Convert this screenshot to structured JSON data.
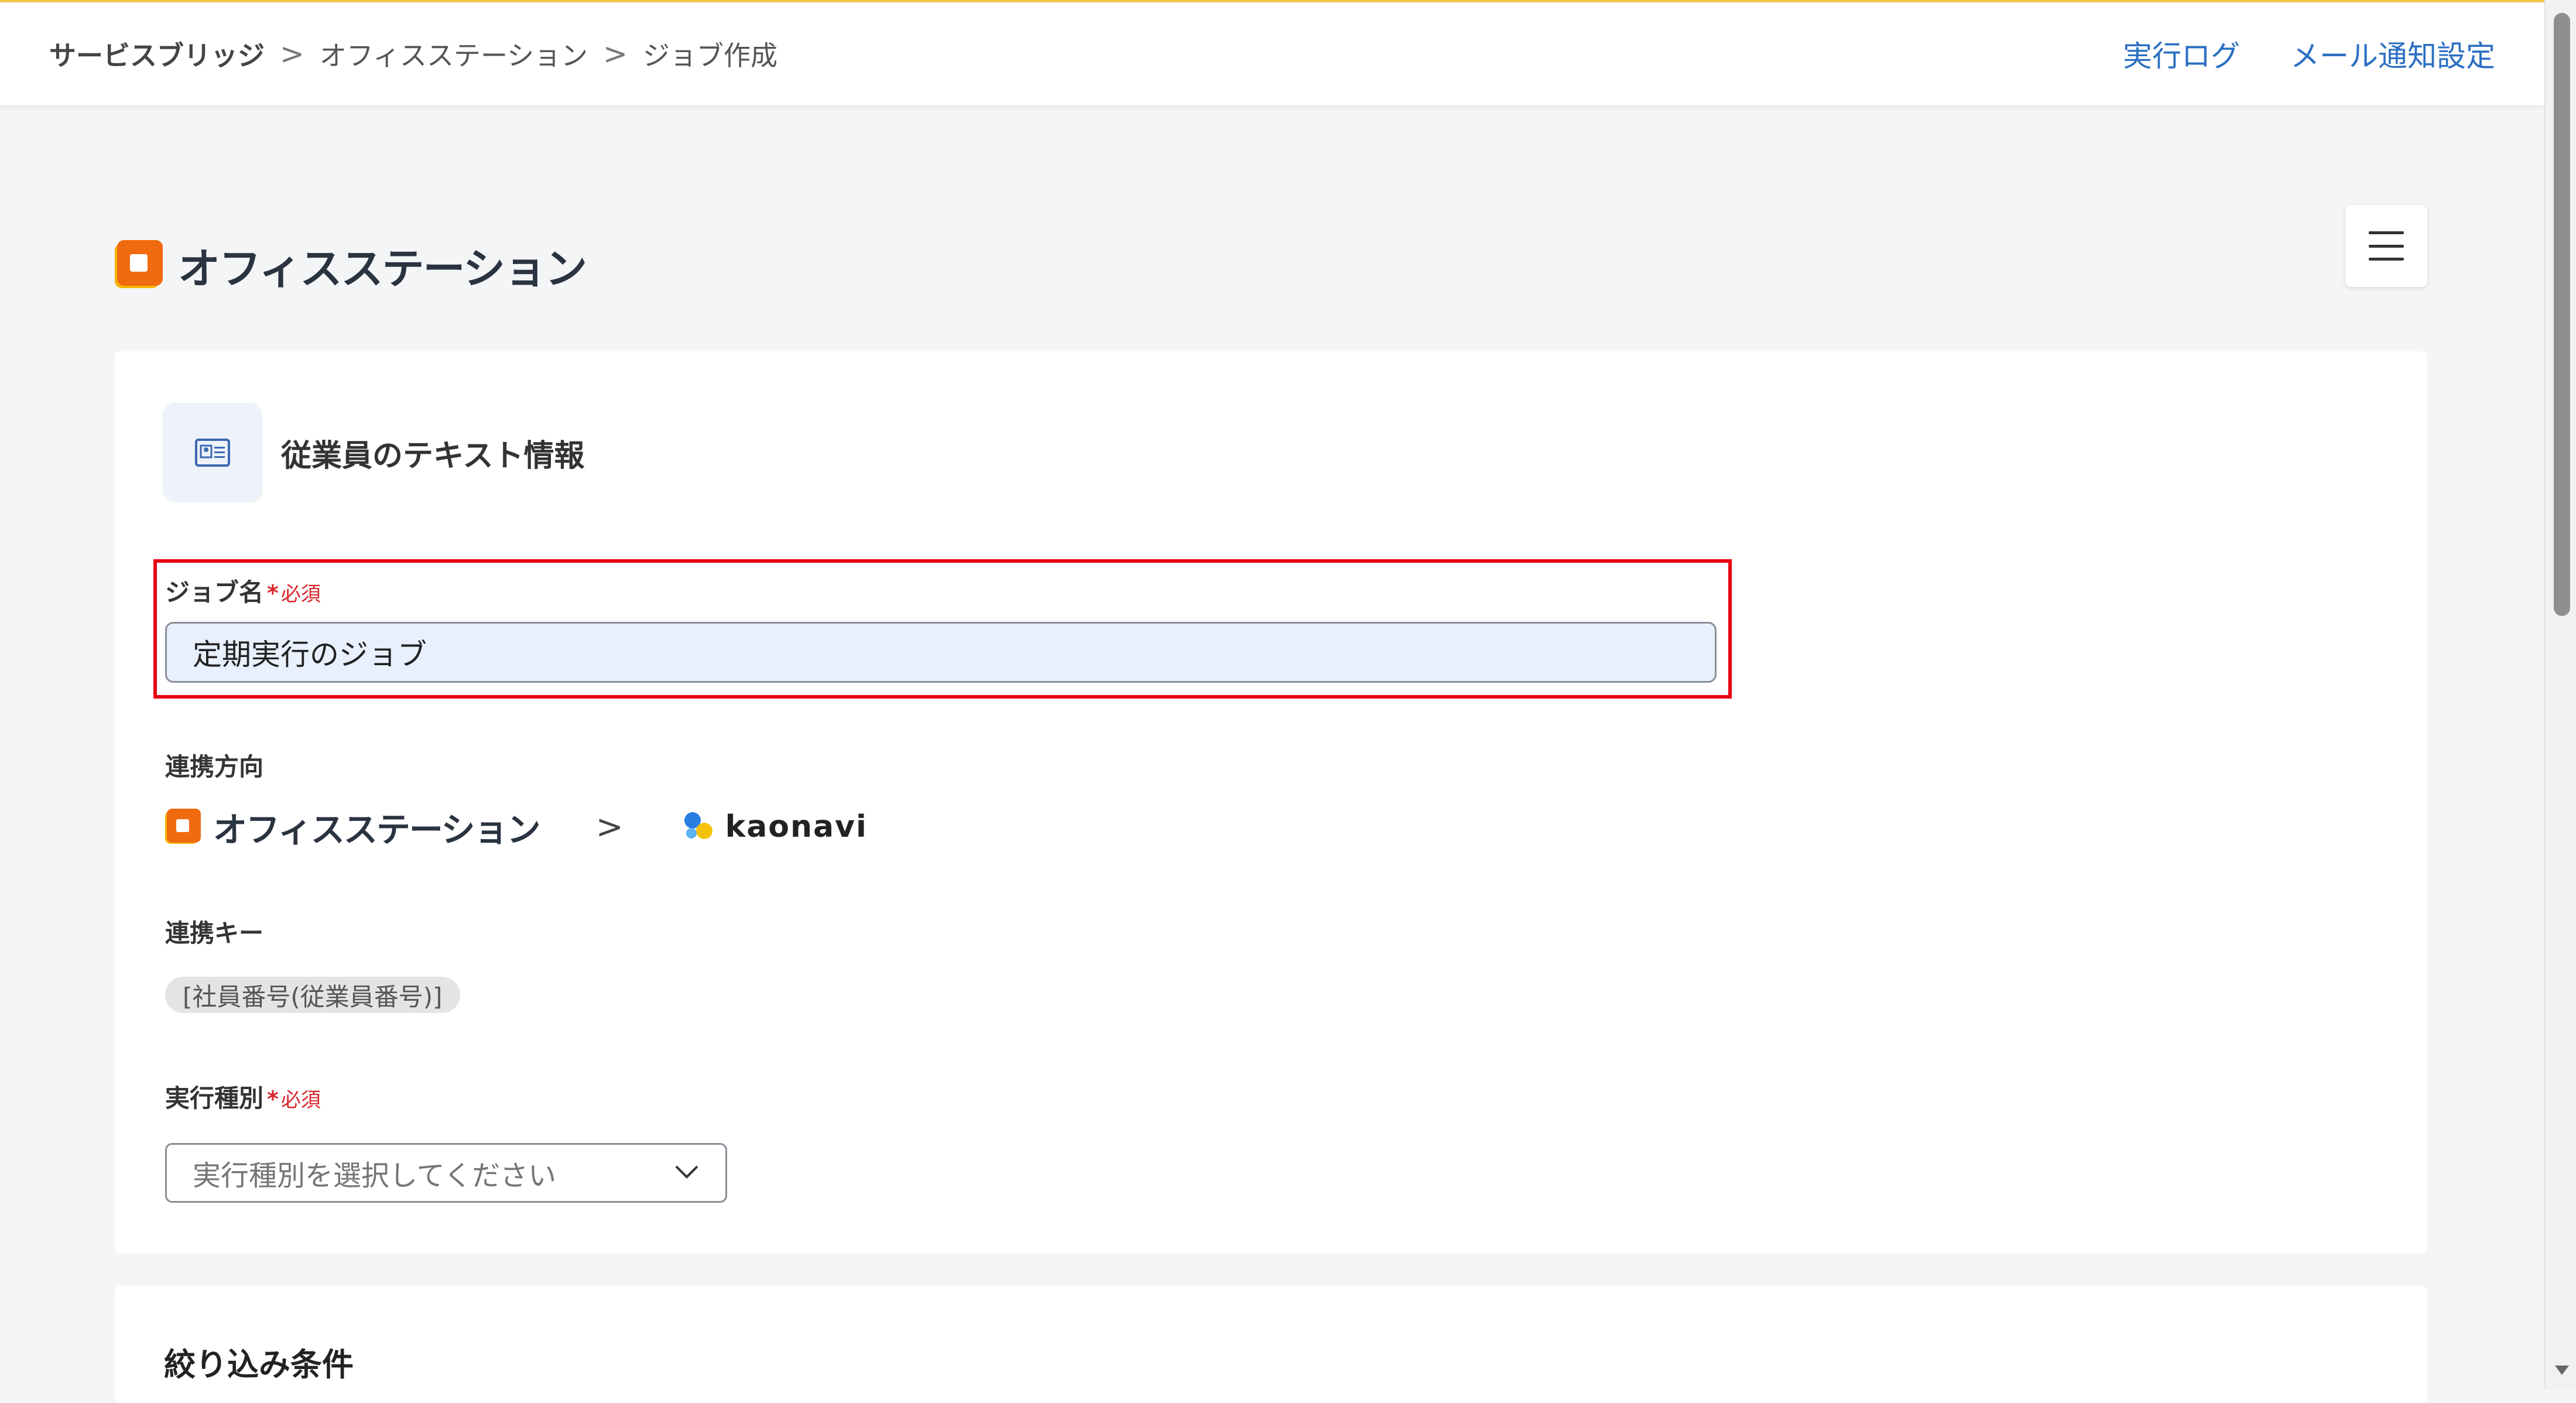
{
  "breadcrumb": {
    "root": "サービスブリッジ",
    "items": [
      "オフィスステーション",
      "ジョブ作成"
    ],
    "separator": ">"
  },
  "header_links": {
    "execution_log": "実行ログ",
    "mail_settings": "メール通知設定"
  },
  "brand": {
    "name": "オフィスステーション"
  },
  "data_type": {
    "label": "従業員のテキスト情報",
    "icon": "id-card-icon"
  },
  "job_name": {
    "label": "ジョブ名",
    "required_mark": "*",
    "required_text": "必須",
    "value": "定期実行のジョブ"
  },
  "direction": {
    "label": "連携方向",
    "source": "オフィスステーション",
    "arrow": ">",
    "target": "kaonavi"
  },
  "link_key": {
    "label": "連携キー",
    "chip": "[社員番号(従業員番号)]"
  },
  "execution_type": {
    "label": "実行種別",
    "required_mark": "*",
    "required_text": "必須",
    "placeholder": "実行種別を選択してください"
  },
  "filter": {
    "title": "絞り込み条件"
  },
  "colors": {
    "accent_link": "#2b6fc2",
    "required": "#d9262b",
    "highlight_border": "#e60012",
    "brand_orange": "#f06a10",
    "brand_yellow": "#f7b500"
  }
}
